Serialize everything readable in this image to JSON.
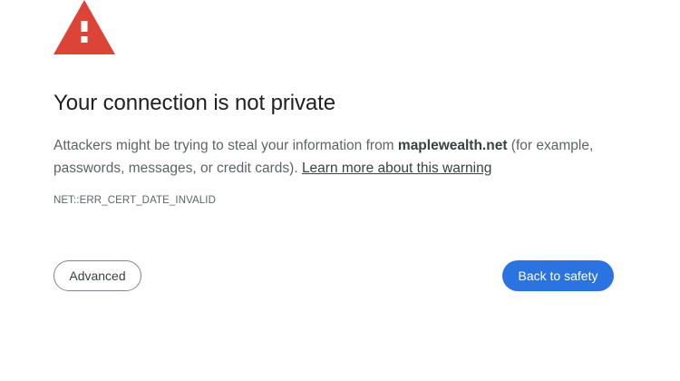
{
  "icon": "warning-triangle-icon",
  "colors": {
    "warning_red": "#db4437",
    "primary_blue": "#2b73e0"
  },
  "title": "Your connection is not private",
  "message": {
    "prefix": "Attackers might be trying to steal your information from ",
    "domain": "maplewealth.net",
    "suffix": " (for example, passwords, messages, or credit cards). ",
    "learn_more": "Learn more about this warning"
  },
  "error_code": "NET::ERR_CERT_DATE_INVALID",
  "buttons": {
    "advanced": "Advanced",
    "back_to_safety": "Back to safety"
  }
}
